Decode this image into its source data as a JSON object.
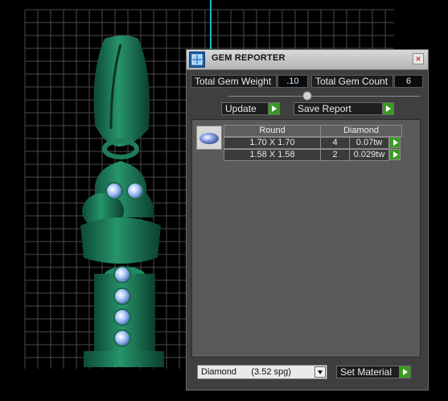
{
  "window": {
    "title": "GEM REPORTER",
    "close_glyph": "×",
    "icon": "gem-reporter-icon"
  },
  "summary": {
    "weight_label": "Total Gem Weight",
    "weight_value": ".10",
    "count_label": "Total Gem Count",
    "count_value": "6"
  },
  "actions": {
    "update_label": "Update",
    "save_label": "Save Report"
  },
  "gem_table": {
    "shape": "Round",
    "material": "Diamond",
    "rows": [
      {
        "size": "1.70 X 1.70",
        "count": "4",
        "weight": "0.07tw"
      },
      {
        "size": "1.58 X 1.58",
        "count": "2",
        "weight": "0.029tw"
      }
    ]
  },
  "material": {
    "selected": "Diamond      (3.52 spg)",
    "set_label": "Set Material"
  },
  "colors": {
    "model_green": "#1c7a5a",
    "gem_blue": "#8fb4f0",
    "accent_green": "#3a9a24",
    "grid_line": "#4a4a4a",
    "axis_cyan": "#1fb5c9"
  }
}
